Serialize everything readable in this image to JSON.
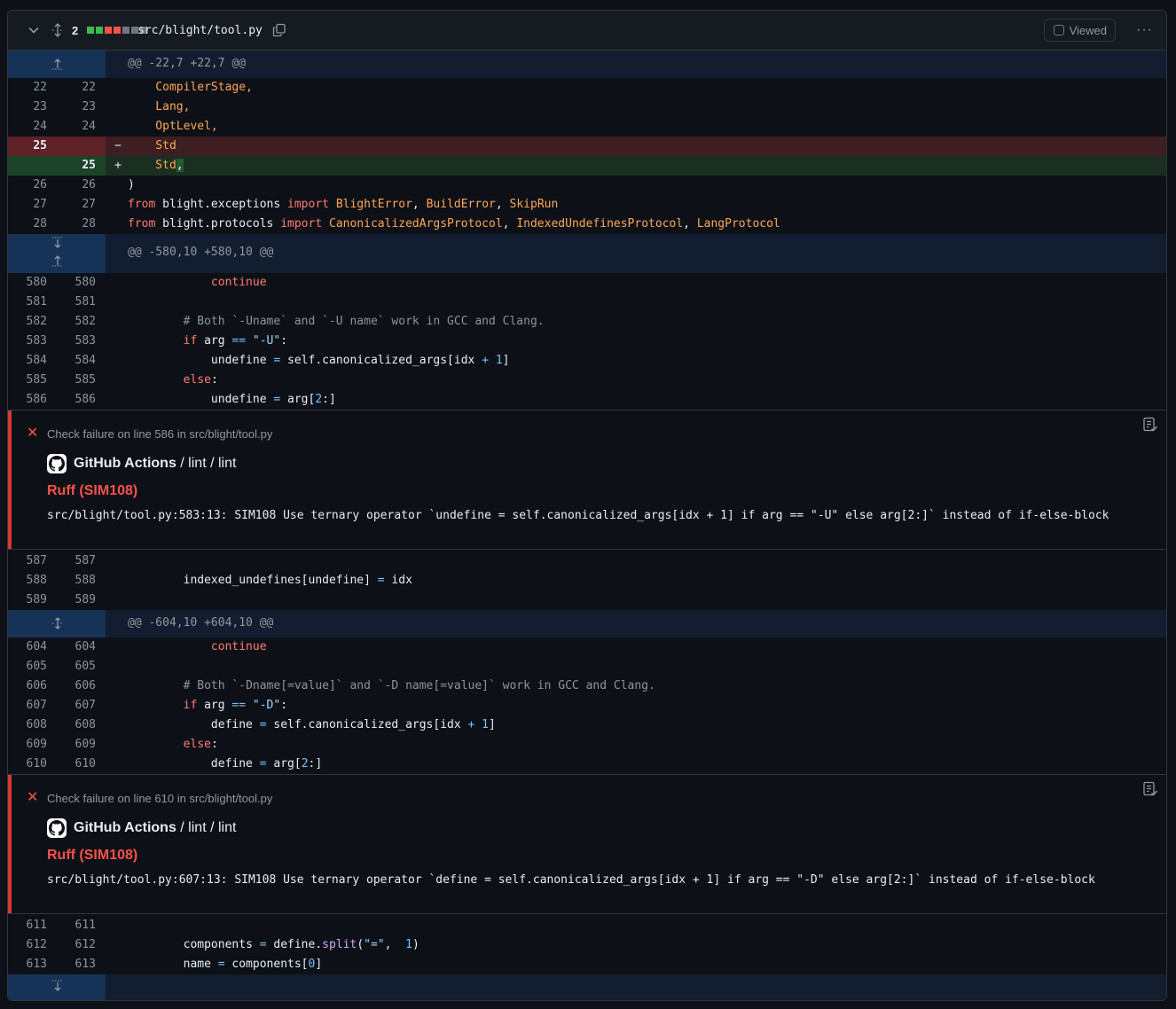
{
  "file": {
    "change_count": "2",
    "path": "src/blight/tool.py",
    "viewed_label": "Viewed",
    "diffstat_colors": [
      "#3fb950",
      "#3fb950",
      "#f85149",
      "#f85149",
      "#6e7681",
      "#6e7681",
      "#6e7681"
    ]
  },
  "hunks": [
    {
      "header": "@@ -22,7 +22,7 @@"
    },
    {
      "header": "@@ -580,10 +580,10 @@"
    },
    {
      "header": "@@ -604,10 +604,10 @@"
    }
  ],
  "rows": {
    "r22": {
      "old": "22",
      "new": "22"
    },
    "r23": {
      "old": "23",
      "new": "23"
    },
    "r24": {
      "old": "24",
      "new": "24"
    },
    "r25d": {
      "old": "25",
      "sign": "−"
    },
    "r25a": {
      "new": "25",
      "sign": "+"
    },
    "r26": {
      "old": "26",
      "new": "26"
    },
    "r27": {
      "old": "27",
      "new": "27"
    },
    "r28": {
      "old": "28",
      "new": "28"
    },
    "r580": {
      "old": "580",
      "new": "580"
    },
    "r581": {
      "old": "581",
      "new": "581"
    },
    "r582": {
      "old": "582",
      "new": "582"
    },
    "r583": {
      "old": "583",
      "new": "583"
    },
    "r584": {
      "old": "584",
      "new": "584"
    },
    "r585": {
      "old": "585",
      "new": "585"
    },
    "r586": {
      "old": "586",
      "new": "586"
    },
    "r587": {
      "old": "587",
      "new": "587"
    },
    "r588": {
      "old": "588",
      "new": "588"
    },
    "r589": {
      "old": "589",
      "new": "589"
    },
    "r604": {
      "old": "604",
      "new": "604"
    },
    "r605": {
      "old": "605",
      "new": "605"
    },
    "r606": {
      "old": "606",
      "new": "606"
    },
    "r607": {
      "old": "607",
      "new": "607"
    },
    "r608": {
      "old": "608",
      "new": "608"
    },
    "r609": {
      "old": "609",
      "new": "609"
    },
    "r610": {
      "old": "610",
      "new": "610"
    },
    "r611": {
      "old": "611",
      "new": "611"
    },
    "r612": {
      "old": "612",
      "new": "612"
    },
    "r613": {
      "old": "613",
      "new": "613"
    }
  },
  "code": {
    "l22": "    CompilerStage,",
    "l23": "    Lang,",
    "l24": "    OptLevel,",
    "l25d": "    Std",
    "l25a_pre": "    Std",
    "l25a_hl": ",",
    "l26": ")",
    "l27_from": "from",
    "l27_mod": " blight.exceptions ",
    "l27_import": "import",
    "l27_n1": " BlightError",
    "l27_c1": ", ",
    "l27_n2": "BuildError",
    "l27_c2": ", ",
    "l27_n3": "SkipRun",
    "l28_from": "from",
    "l28_mod": " blight.protocols ",
    "l28_import": "import",
    "l28_n1": " CanonicalizedArgsProtocol",
    "l28_c1": ", ",
    "l28_n2": "IndexedUndefinesProtocol",
    "l28_c2": ", ",
    "l28_n3": "LangProtocol",
    "continue": "continue",
    "l582": "# Both `-Uname` and `-U name` work in GCC and Clang.",
    "if": "if",
    "arg": " arg ",
    "eq": "==",
    "str_u": "\"-U\"",
    "colon": ":",
    "l584_a": "undefine ",
    "assign": "=",
    "l584_b": " self.canonicalized_args[idx ",
    "plus": "+",
    "one": " 1",
    "rb": "]",
    "else": "else",
    "l586_a": "undefine ",
    "l586_b": " arg[",
    "two": "2",
    "l586_c": ":]",
    "l588_a": "indexed_undefines[undefine] ",
    "l588_b": " idx",
    "l606": "# Both `-Dname[=value]` and `-D name[=value]` work in GCC and Clang.",
    "str_d": "\"-D\"",
    "l608_a": "define ",
    "l610_a": "define ",
    "l612_a": "components ",
    "l612_b": " define.",
    "split": "split",
    "l612_c": "(",
    "str_eq": "\"=\"",
    "l612_d": ", ",
    "l612_e": ")",
    "l613_a": "name ",
    "l613_b": " components[",
    "zero": "0",
    "l613_c": "]"
  },
  "annotations": [
    {
      "title": "Check failure on line 586 in src/blight/tool.py",
      "source": "GitHub Actions",
      "path": " / lint / lint",
      "rule": "Ruff (SIM108)",
      "message": "src/blight/tool.py:583:13: SIM108 Use ternary operator `undefine = self.canonicalized_args[idx + 1] if arg == \"-U\" else arg[2:]` instead of if-else-block"
    },
    {
      "title": "Check failure on line 610 in src/blight/tool.py",
      "source": "GitHub Actions",
      "path": " / lint / lint",
      "rule": "Ruff (SIM108)",
      "message": "src/blight/tool.py:607:13: SIM108 Use ternary operator `define = self.canonicalized_args[idx + 1] if arg == \"-D\" else arg[2:]` instead of if-else-block"
    }
  ]
}
